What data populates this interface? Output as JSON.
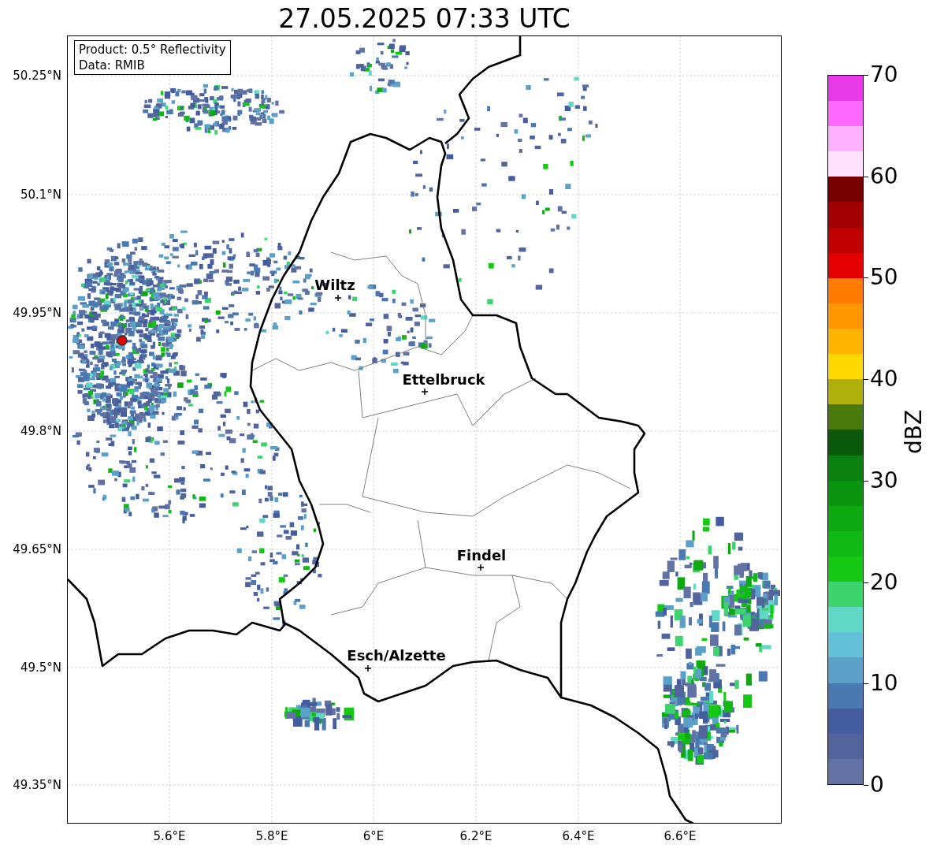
{
  "title": "27.05.2025 07:33 UTC",
  "info_box": [
    "Product: 0.5° Reflectivity",
    "Data: RMIB"
  ],
  "map": {
    "x_ticks": [
      "5.6°E",
      "5.8°E",
      "6°E",
      "6.2°E",
      "6.4°E",
      "6.6°E"
    ],
    "y_ticks": [
      "50.25°N",
      "50.1°N",
      "49.95°N",
      "49.8°N",
      "49.65°N",
      "49.5°N",
      "49.35°N"
    ],
    "cities": [
      {
        "name": "Wiltz"
      },
      {
        "name": "Ettelbruck"
      },
      {
        "name": "Findel"
      },
      {
        "name": "Esch/Alzette"
      }
    ]
  },
  "colorbar": {
    "label": "dBZ",
    "ticks": [
      "70",
      "60",
      "50",
      "40",
      "30",
      "20",
      "10",
      "0"
    ],
    "bins": [
      {
        "color": "#6272a4"
      },
      {
        "color": "#52649c"
      },
      {
        "color": "#445ca0"
      },
      {
        "color": "#4a78b0"
      },
      {
        "color": "#5aa0c8"
      },
      {
        "color": "#64c0d8"
      },
      {
        "color": "#60d8c8"
      },
      {
        "color": "#3cd46c"
      },
      {
        "color": "#14c814"
      },
      {
        "color": "#10b814"
      },
      {
        "color": "#0ea810"
      },
      {
        "color": "#0a940e"
      },
      {
        "color": "#0a800e"
      },
      {
        "color": "#0a5a0a"
      },
      {
        "color": "#4a7a0c"
      },
      {
        "color": "#b0b00a"
      },
      {
        "color": "#ffd800"
      },
      {
        "color": "#ffb400"
      },
      {
        "color": "#ff9800"
      },
      {
        "color": "#ff7c00"
      },
      {
        "color": "#e40000"
      },
      {
        "color": "#c00000"
      },
      {
        "color": "#a00000"
      },
      {
        "color": "#780000"
      },
      {
        "color": "#ffe0ff"
      },
      {
        "color": "#ffb0ff"
      },
      {
        "color": "#ff68ff"
      },
      {
        "color": "#e838e8"
      }
    ]
  }
}
